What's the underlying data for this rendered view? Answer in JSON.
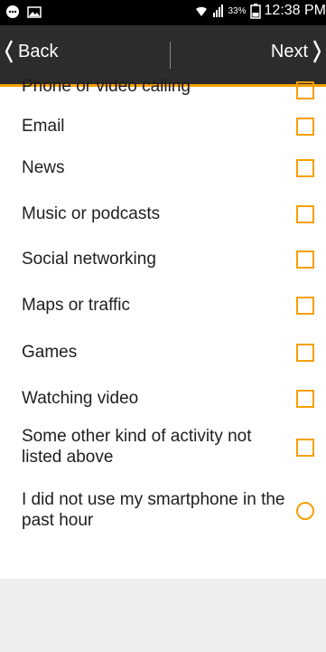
{
  "status_bar": {
    "battery_percent": "33%",
    "time": "12:38 PM",
    "icons": [
      "chat-bubble-icon",
      "image-icon",
      "wifi-icon",
      "signal-icon",
      "battery-icon"
    ]
  },
  "nav": {
    "back_label": "Back",
    "next_label": "Next"
  },
  "options": [
    {
      "label": "Phone or video calling",
      "control": "checkbox",
      "checked": false
    },
    {
      "label": "Email",
      "control": "checkbox",
      "checked": false
    },
    {
      "label": "News",
      "control": "checkbox",
      "checked": false
    },
    {
      "label": "Music or podcasts",
      "control": "checkbox",
      "checked": false
    },
    {
      "label": "Social networking",
      "control": "checkbox",
      "checked": false
    },
    {
      "label": "Maps or traffic",
      "control": "checkbox",
      "checked": false
    },
    {
      "label": "Games",
      "control": "checkbox",
      "checked": false
    },
    {
      "label": "Watching video",
      "control": "checkbox",
      "checked": false
    },
    {
      "label": "Some other kind of activity not listed above",
      "control": "checkbox",
      "checked": false
    },
    {
      "label": "I did not use my smartphone in the past hour",
      "control": "radio",
      "checked": false
    }
  ],
  "colors": {
    "accent": "#f5a000",
    "nav_background": "#2c2c2c",
    "status_background": "#000000"
  }
}
